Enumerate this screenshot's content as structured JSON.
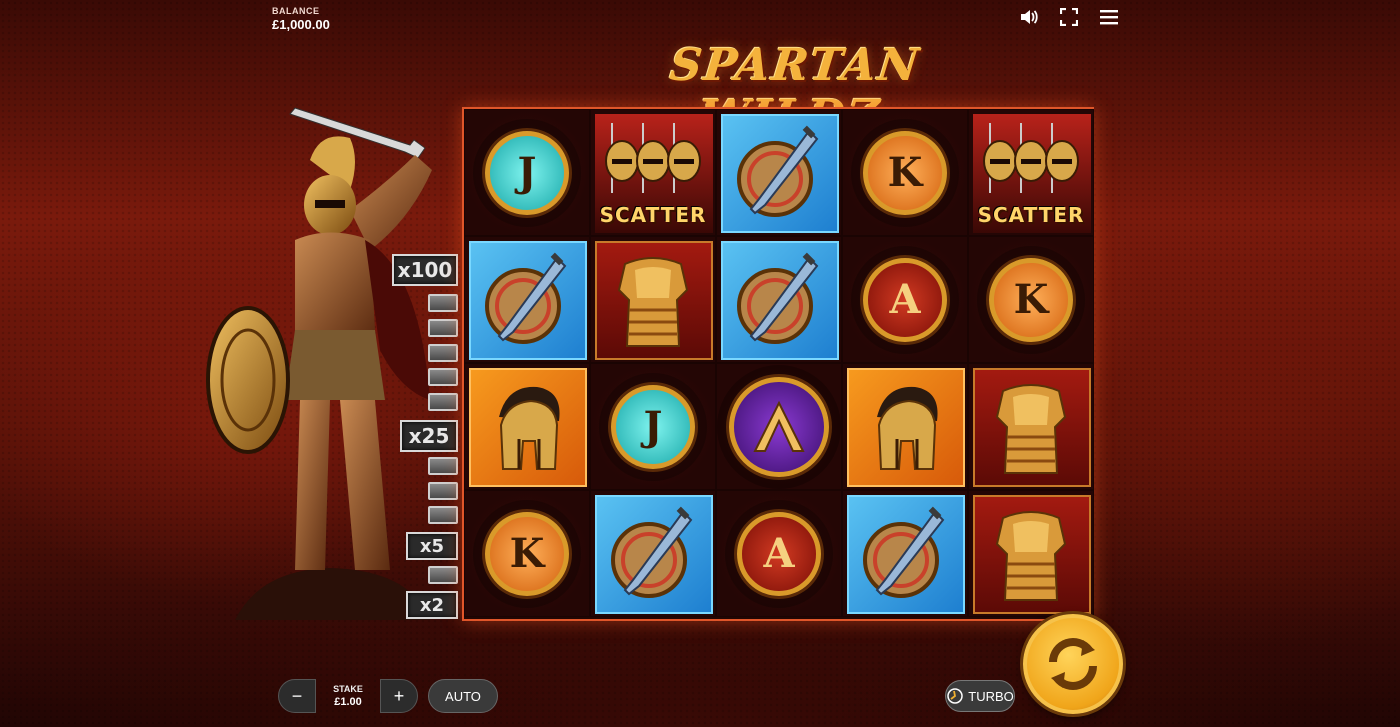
{
  "header": {
    "balance_label": "BALANCE",
    "balance_value": "£1,000.00",
    "icons": [
      "volume-icon",
      "fullscreen-icon",
      "menu-icon"
    ]
  },
  "logo": {
    "title": "SPARTAN WILDZ"
  },
  "ladder": {
    "multipliers": [
      {
        "label": "x100"
      },
      {
        "label": "x25"
      },
      {
        "label": "x5"
      },
      {
        "label": "x2"
      }
    ]
  },
  "reels": {
    "rows": [
      [
        "J",
        "SCATTER",
        "SHIELD_SWORD",
        "K",
        "SCATTER"
      ],
      [
        "SHIELD_SWORD",
        "ARMOR",
        "SHIELD_SWORD",
        "A",
        "K"
      ],
      [
        "HELMET",
        "J",
        "LAMBDA",
        "HELMET",
        "ARMOR"
      ],
      [
        "K",
        "SHIELD_SWORD",
        "A",
        "SHIELD_SWORD",
        "ARMOR"
      ]
    ],
    "scatter_label": "SCATTER",
    "colors": {
      "frame": "#e0562a",
      "blue": "#1e7fd0",
      "orange": "#d75a0a",
      "red": "#a31a10"
    }
  },
  "controls": {
    "minus": "−",
    "plus": "+",
    "stake_label": "STAKE",
    "stake_value": "£1.00",
    "auto": "AUTO",
    "turbo": "TURBO"
  }
}
